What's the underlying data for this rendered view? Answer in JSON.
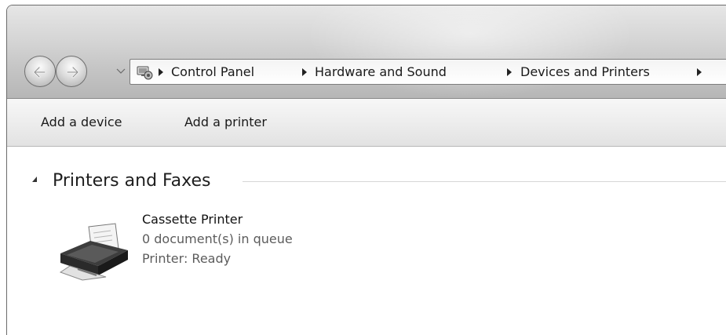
{
  "navigation": {
    "back_icon": "back-arrow-icon",
    "forward_icon": "forward-arrow-icon",
    "history_icon": "chevron-down-icon"
  },
  "address_bar": {
    "location_icon": "control-panel-icon",
    "breadcrumbs": [
      {
        "label": "Control Panel"
      },
      {
        "label": "Hardware and Sound"
      },
      {
        "label": "Devices and Printers"
      }
    ]
  },
  "toolbar": {
    "add_device_label": "Add a device",
    "add_printer_label": "Add a printer"
  },
  "group": {
    "title": "Printers and Faxes",
    "expanded": true
  },
  "devices": [
    {
      "icon": "printer-icon",
      "name": "Cassette Printer",
      "queue": "0 document(s) in queue",
      "status": "Printer:  Ready"
    }
  ],
  "colors": {
    "chrome_top": "#e6e6e6",
    "chrome_bottom": "#b6b6b6",
    "toolbar": "#ececec",
    "background": "#ffffff"
  }
}
